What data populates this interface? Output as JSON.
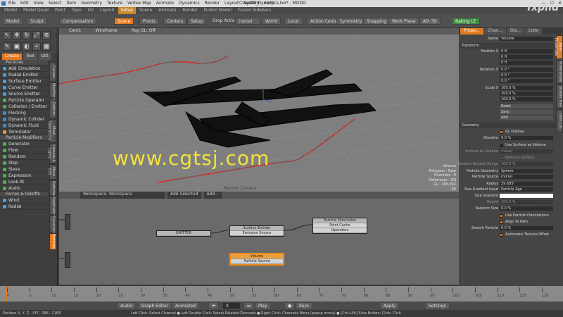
{
  "app": {
    "title": "Class08_Dynamics.lxo* - MODO",
    "menu": [
      "File",
      "Edit",
      "View",
      "Select",
      "Item",
      "Geometry",
      "Texture",
      "Vertex Map",
      "Animate",
      "Dynamics",
      "Render",
      "Layout",
      "System",
      "Help"
    ],
    "window_buttons": [
      "—",
      "☐",
      "✕"
    ]
  },
  "layout_tabs": [
    "Model",
    "Model Quad",
    "Paint",
    "Topo",
    "UV",
    "Layout",
    "Setup",
    "Scene",
    "Animate",
    "Render",
    "Fusion Model",
    "Fusion Sidebars"
  ],
  "active_layout_tab": "Setup",
  "toolbar": {
    "model": "Model",
    "sculpt": "Sculpt",
    "compensation": "Compensation",
    "scene": "Scene",
    "pivots": "Pivots",
    "centers": "Centers",
    "setup": "Setup",
    "drop_action": "Drop Action:",
    "drop_value": "(none)",
    "world": "World",
    "local": "Local",
    "action_center": "Action Center",
    "symmetry": "Symmetry: Off",
    "snapping": "Snapping",
    "work_plane": "Work Plane",
    "afx": "Afx 3D",
    "baking": "Baking LE"
  },
  "left_panel": {
    "tabs": [
      "Create",
      "Tool",
      "Util"
    ],
    "sections": [
      {
        "title": "Particles",
        "items": [
          "Add Simulation",
          "Radial Emitter",
          "Surface Emitter",
          "Curve Emitter",
          "Source Emitter",
          "Particle Operator",
          "Collector / Emitter",
          "Flocking",
          "Dynamic Collider",
          "Dynamic Fluid",
          "Terminator"
        ]
      },
      {
        "title": "Particle Modifiers",
        "items": [
          "Generator",
          "Flow",
          "Random",
          "Step",
          "Sieve",
          "Expression",
          "Look At",
          "Audio"
        ]
      },
      {
        "title": "Forces & Falloffs",
        "items": [
          "Wind",
          "Radial"
        ]
      }
    ],
    "vertical_tabs": [
      "Curves",
      "Modifiers",
      "Deform",
      "Mesh Operations",
      "Camera & Lights",
      "Mesh Edit",
      "Deformers",
      "Replicators",
      "Dynamics",
      "Particles"
    ]
  },
  "viewport": {
    "header": [
      "Cam1",
      "Wireframe",
      "Ray GL: Off"
    ],
    "info": [
      "Volume",
      "Polygons : Face",
      "Channels : 0",
      "Deformers : ON",
      "GL : 269,892",
      "50"
    ],
    "camera_label": "Render Camera"
  },
  "watermark": "www.cgtsj.com",
  "corner_logo": "fxphd",
  "schematic": {
    "workspace": "Workspace: Workspace",
    "add_selected": "Add Selected",
    "add": "Add...",
    "nodes": [
      {
        "title": "EMITTER",
        "rows": []
      },
      {
        "title": "Surface Emitter",
        "rows": [
          "Emission Source"
        ]
      },
      {
        "title": "Particle Simulation",
        "rows": [
          "Point Cache",
          "Operators"
        ]
      },
      {
        "title": "Volume",
        "rows": [
          "Particle Source"
        ]
      }
    ]
  },
  "properties": {
    "tabs": [
      "Prope...",
      "Chan...",
      "Dis...",
      "Lists"
    ],
    "name": "Volume",
    "transform_title": "Transform",
    "position": [
      "0 ft",
      "0 ft",
      "0 ft"
    ],
    "rotation": [
      "0.0 °",
      "0.0 °",
      "0.0 °"
    ],
    "scale": [
      "100.0 %",
      "100.0 %",
      "100.0 %"
    ],
    "buttons": [
      "Reset",
      "Zero",
      "Add"
    ],
    "geometry_title": "Geometry",
    "gl_display": "GL Display",
    "dissolve": "0.0 %",
    "use_surface": "Use Surface as Volume",
    "surface_as_volume": "(none)",
    "remove_surface": "Remove Surface",
    "surface_density_range": "100.0 %",
    "particle_geometry": "Sphere",
    "particle_source": "(none)",
    "radius": "29.685\"",
    "size_gradient_input": "Particle Age",
    "size_gradient": "",
    "height": "100.0 %",
    "random_size": "0.0 %",
    "use_particle_orientations": "Use Particle Orientations",
    "align_to_path": "Align To Path",
    "stretch_particle": "0.0 %",
    "auto_texture_offset": "Automatic Texture Offset",
    "labels": {
      "name": "Name",
      "position": "Position X",
      "rotation": "Rotation X",
      "scale": "Scale X",
      "dissolve": "Dissolve",
      "surface_as_volume": "Surface As Volume",
      "surface_density": "Surface Density Range",
      "particle_geometry": "Particle Geometry",
      "particle_source": "Particle Source",
      "radius": "Radius",
      "size_gradient_input": "Size Gradient Input",
      "size_gradient": "Size Gradient",
      "height": "Height",
      "random_size": "Random Size",
      "stretch": "Stretch Particle"
    },
    "side_tabs": [
      "Item Properties",
      "Preferences",
      "Shader Tree",
      "Item List"
    ]
  },
  "timeline": {
    "ticks": [
      "0",
      "5",
      "10",
      "15",
      "20",
      "25",
      "30",
      "35",
      "40",
      "45",
      "50",
      "55",
      "60",
      "65",
      "70",
      "75",
      "80",
      "85",
      "90",
      "95",
      "100",
      "105",
      "110",
      "115",
      "120"
    ],
    "current": "0",
    "end": "120"
  },
  "transport": {
    "audio": "Audio",
    "graph_editor": "Graph Editor",
    "animated": "Animated",
    "frame": "0",
    "play": "Play",
    "keys": "Keys",
    "apply": "Apply",
    "settings": "Settings"
  },
  "status": {
    "position": "Position X, Y, Z:  -50!', 396', 1183'",
    "hint": "Left Click: Select Channel ● Left Double Click: Select Related Channels ● Right Click: Channels Menu (popup menu) ● [Ctrl+Alt] Slice Button: Click: Click"
  }
}
